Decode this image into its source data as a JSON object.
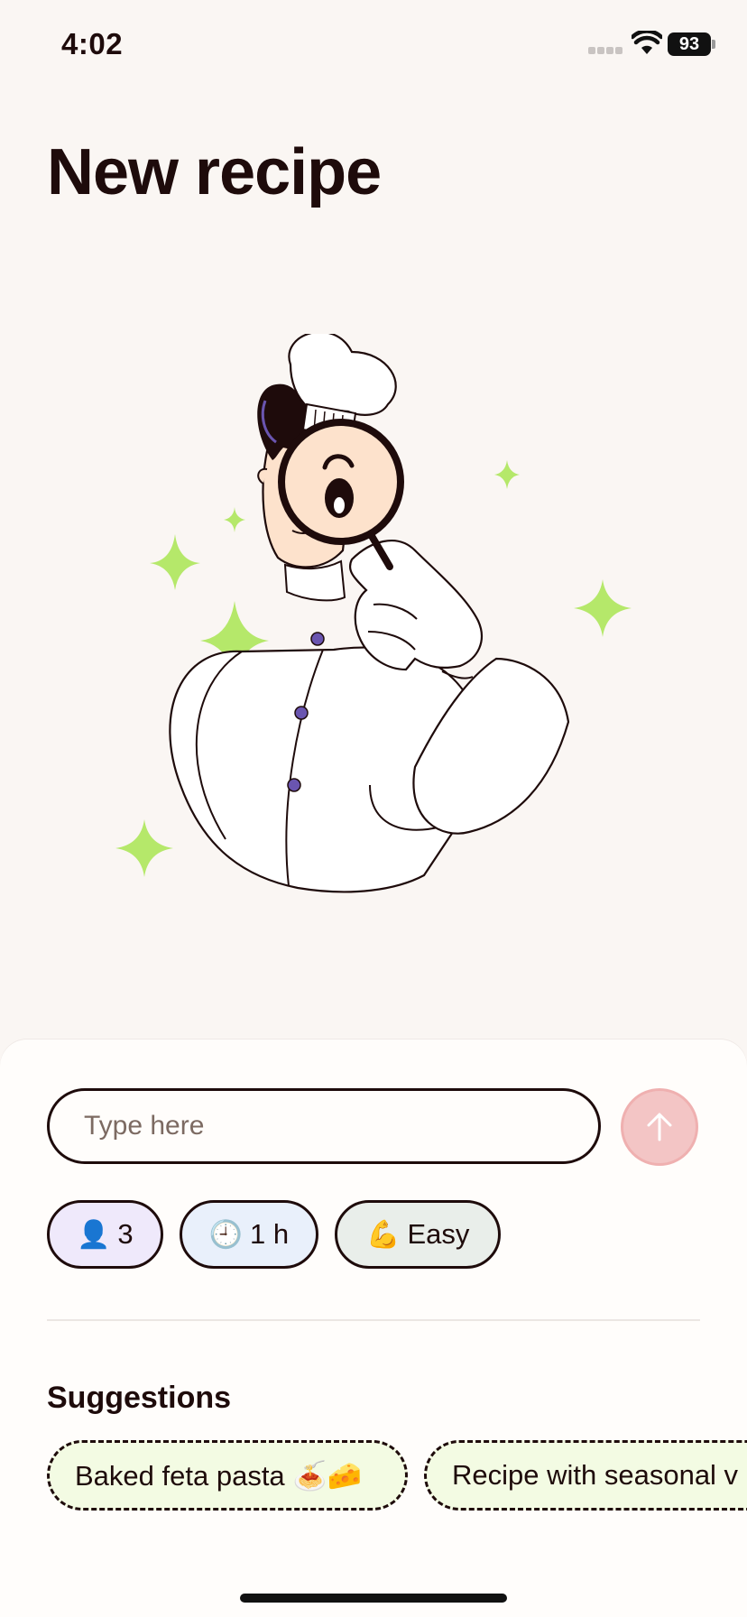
{
  "status_bar": {
    "time": "4:02",
    "battery": "93"
  },
  "page": {
    "title": "New recipe"
  },
  "prompt": {
    "placeholder": "Type here",
    "value": ""
  },
  "options": [
    {
      "emoji": "👤",
      "label": "3"
    },
    {
      "emoji": "🕘",
      "label": "1 h"
    },
    {
      "emoji": "💪",
      "label": "Easy"
    }
  ],
  "suggestions": {
    "title": "Suggestions",
    "items": [
      {
        "label": "Baked feta pasta 🍝🧀"
      },
      {
        "label": "Recipe with seasonal v"
      }
    ]
  },
  "colors": {
    "background": "#faf6f3",
    "text": "#1e0b0b",
    "accent_green": "#b5e86a",
    "send_button": "#f3c5c5",
    "button_dot": "#6a55b0"
  }
}
